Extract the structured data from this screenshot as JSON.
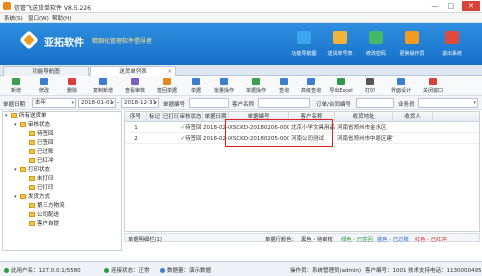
{
  "window": {
    "title": "信管飞送货单软件 V8.5.226",
    "min": "—",
    "max": "□",
    "close": "✕"
  },
  "menu": [
    "系统(S)",
    "窗口(W)",
    "帮助(H)"
  ],
  "banner": {
    "brand": "亚拓软件",
    "slogan": "精细化管理软件倡导者",
    "buttons": [
      {
        "label": "功能导航图",
        "color": "#3ea6ef"
      },
      {
        "label": "送货单号表",
        "color": "#f0b43a"
      },
      {
        "label": "修改密码",
        "color": "#46b86a"
      },
      {
        "label": "更换操作员",
        "color": "#f29b1e"
      },
      {
        "label": "退出系统",
        "color": "#e04a3a"
      }
    ]
  },
  "tabs": {
    "function": "功能导航图",
    "sender": "送货单列表",
    "close": "✕"
  },
  "toolbar": [
    {
      "label": "新增",
      "color": "#3aa24a"
    },
    {
      "label": "修改",
      "color": "#3a7fd0"
    },
    {
      "label": "删除",
      "color": "#d84040"
    },
    {
      "label": "复制新增",
      "color": "#3a7fd0"
    },
    {
      "label": "查看审核",
      "color": "#7a5fc0"
    },
    {
      "label": "签回单据",
      "color": "#e08a20"
    },
    {
      "label": "单据",
      "color": "#3a7fd0"
    },
    {
      "label": "批量操作",
      "color": "#3a7fd0"
    },
    {
      "label": "单据操作",
      "color": "#3aa24a"
    },
    {
      "label": "查询",
      "color": "#3a7fd0"
    },
    {
      "label": "高级查询",
      "color": "#3a7fd0"
    },
    {
      "label": "导出Excel",
      "color": "#2f9a4a"
    },
    {
      "label": "打印",
      "color": "#555555"
    },
    {
      "label": "界面设计",
      "color": "#3a7fd0"
    },
    {
      "label": "关闭窗口",
      "color": "#d84040"
    }
  ],
  "filter": {
    "date_label": "单据日期",
    "period": "本年",
    "date_from": "2018-01-01",
    "date_to": "2018-12-31",
    "bill_no_label": "单据编号",
    "bill_no": "",
    "customer_label": "客户名称",
    "customer": "",
    "order_label": "订单/合同编号",
    "order": "",
    "sales_label": "业务员",
    "sales": ""
  },
  "tree": [
    {
      "label": "所有送货单",
      "level": 0,
      "exp": "▾"
    },
    {
      "label": "审核状态",
      "level": 1,
      "exp": "▾"
    },
    {
      "label": "待签回",
      "level": 2,
      "exp": ""
    },
    {
      "label": "已签回",
      "level": 2,
      "exp": ""
    },
    {
      "label": "已过账",
      "level": 2,
      "exp": ""
    },
    {
      "label": "已红冲",
      "level": 2,
      "exp": ""
    },
    {
      "label": "打印状态",
      "level": 1,
      "exp": "▾"
    },
    {
      "label": "未打印",
      "level": 2,
      "exp": ""
    },
    {
      "label": "已打印",
      "level": 2,
      "exp": ""
    },
    {
      "label": "发货方式",
      "level": 1,
      "exp": "▾"
    },
    {
      "label": "第三方物流",
      "level": 2,
      "exp": ""
    },
    {
      "label": "公司配送",
      "level": 2,
      "exp": ""
    },
    {
      "label": "客户自提",
      "level": 2,
      "exp": ""
    }
  ],
  "grid": {
    "headers": [
      "序号",
      "标记",
      "已打印",
      "审核状态",
      "单据日期",
      "单据编号",
      "客户名称",
      "收货地址",
      "收货人"
    ],
    "rows": [
      {
        "no": "1",
        "mark": "",
        "printed": "",
        "status": "待签回",
        "date": "2018-02-06",
        "bill": "XSCKD-20180206-0001",
        "customer": "北京小学文具用品店",
        "address": "河南省郑州市金水区",
        "receiver": ""
      },
      {
        "no": "2",
        "mark": "",
        "printed": "",
        "status": "待签回",
        "date": "2018-02-05",
        "bill": "XSCKD-20180205-0001",
        "customer": "河南公司测试",
        "address": "河南省郑州市中原区建设",
        "receiver": ""
      }
    ],
    "check": "✓"
  },
  "gridbottom": {
    "left": "单据明细栏(1)",
    "legend_label": "单据行颜色：",
    "items": [
      {
        "label": "黑色 - 待审核",
        "color": "#333333"
      },
      {
        "label": "绿色 - 已签回",
        "color": "#2a9a3a"
      },
      {
        "label": "蓝色 - 已过账",
        "color": "#2a6ad0"
      },
      {
        "label": "红色 - 已红冲",
        "color": "#d83030"
      }
    ]
  },
  "statusbar": {
    "server": "此用户名：127.0.0.1/5580",
    "connect": "连接状态：正常",
    "data": "数据量：演示数据",
    "operator": "操作员：系统管理员(admin)",
    "customer": "客户编号：1001",
    "phone": "技术支持电话：11300",
    "phone_tail": "00495"
  }
}
